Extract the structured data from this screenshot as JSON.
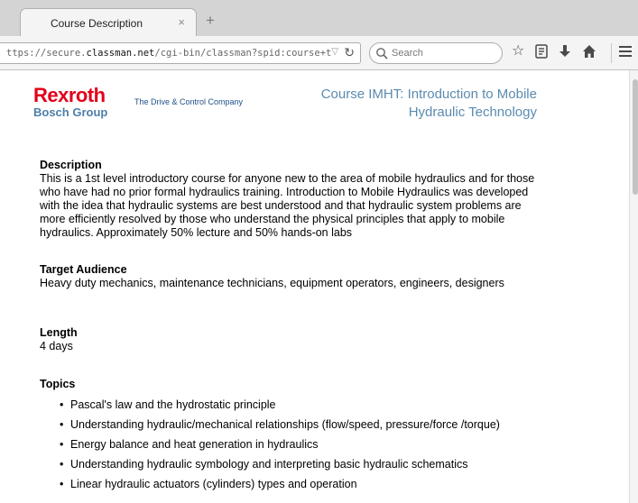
{
  "browser": {
    "tab_title": "Course Description",
    "tab_close": "×",
    "new_tab": "+",
    "url_prefix": "ttps://secure.",
    "url_domain": "classman.net",
    "url_path": "/cgi-bin/classman?spid:course+tpid:c​",
    "search_placeholder": "Search"
  },
  "page": {
    "logo_main": "Rexroth",
    "logo_sub": "Bosch Group",
    "tagline": "The Drive & Control Company",
    "title_line1": "Course IMHT: Introduction to Mobile",
    "title_line2": "Hydraulic Technology",
    "description_heading": "Description",
    "description_text": "This is a 1st level introductory course for anyone new to the area of mobile hydraulics and for those who have had no prior formal hydraulics training. Introduction to Mobile Hydraulics was developed with the idea that hydraulic systems are best understood and that hydraulic system problems are more efficiently resolved by those who understand the physical principles that apply to mobile hydraulics. Approximately 50% lecture and 50% hands-on labs",
    "audience_heading": "Target Audience",
    "audience_text": "Heavy duty mechanics, maintenance technicians, equipment operators, engineers, designers",
    "length_heading": "Length",
    "length_text": "4 days",
    "topics_heading": "Topics",
    "topics": [
      "Pascal's law and the hydrostatic principle",
      "Understanding hydraulic/mechanical relationships (flow/speed, pressure/force /torque)",
      "Energy balance and heat generation in hydraulics",
      "Understanding hydraulic symbology and interpreting basic hydraulic schematics",
      "Linear hydraulic actuators (cylinders) types and operation"
    ]
  }
}
